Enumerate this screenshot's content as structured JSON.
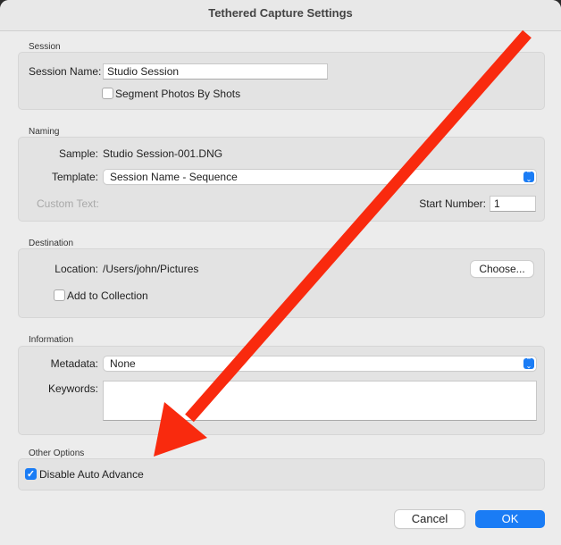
{
  "title": "Tethered Capture Settings",
  "session": {
    "heading": "Session",
    "name_label": "Session Name:",
    "name_value": "Studio Session",
    "segment_label": "Segment Photos By Shots",
    "segment_checked": false
  },
  "naming": {
    "heading": "Naming",
    "sample_label": "Sample:",
    "sample_value": "Studio Session-001.DNG",
    "template_label": "Template:",
    "template_value": "Session Name - Sequence",
    "custom_text_label": "Custom Text:",
    "start_number_label": "Start Number:",
    "start_number_value": "1"
  },
  "destination": {
    "heading": "Destination",
    "location_label": "Location:",
    "location_value": "/Users/john/Pictures",
    "choose_label": "Choose...",
    "add_collection_label": "Add to Collection",
    "add_collection_checked": false
  },
  "information": {
    "heading": "Information",
    "metadata_label": "Metadata:",
    "metadata_value": "None",
    "keywords_label": "Keywords:",
    "keywords_value": ""
  },
  "other": {
    "heading": "Other Options",
    "disable_auto_advance_label": "Disable Auto Advance",
    "disable_auto_advance_checked": true
  },
  "buttons": {
    "cancel": "Cancel",
    "ok": "OK"
  },
  "colors": {
    "accent": "#1a7cf5",
    "annotation_arrow": "#f92a0e"
  }
}
